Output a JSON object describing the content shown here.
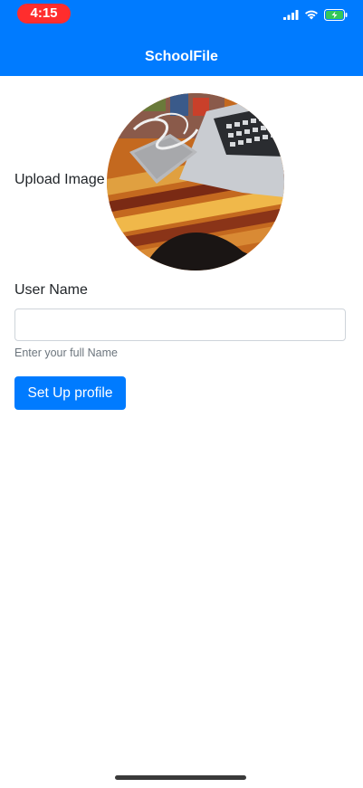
{
  "status_bar": {
    "time": "4:15",
    "icons": [
      "cellular-signal-icon",
      "wifi-icon",
      "battery-charging-icon"
    ]
  },
  "nav": {
    "title": "SchoolFile"
  },
  "form": {
    "upload_label": "Upload Image",
    "username_label": "User Name",
    "username_value": "",
    "username_help": "Enter your full Name",
    "submit_label": "Set Up profile"
  },
  "colors": {
    "primary": "#007bff",
    "time_pill": "#ff2d2d",
    "help_text": "#6c757d",
    "input_border": "#ced4da"
  }
}
